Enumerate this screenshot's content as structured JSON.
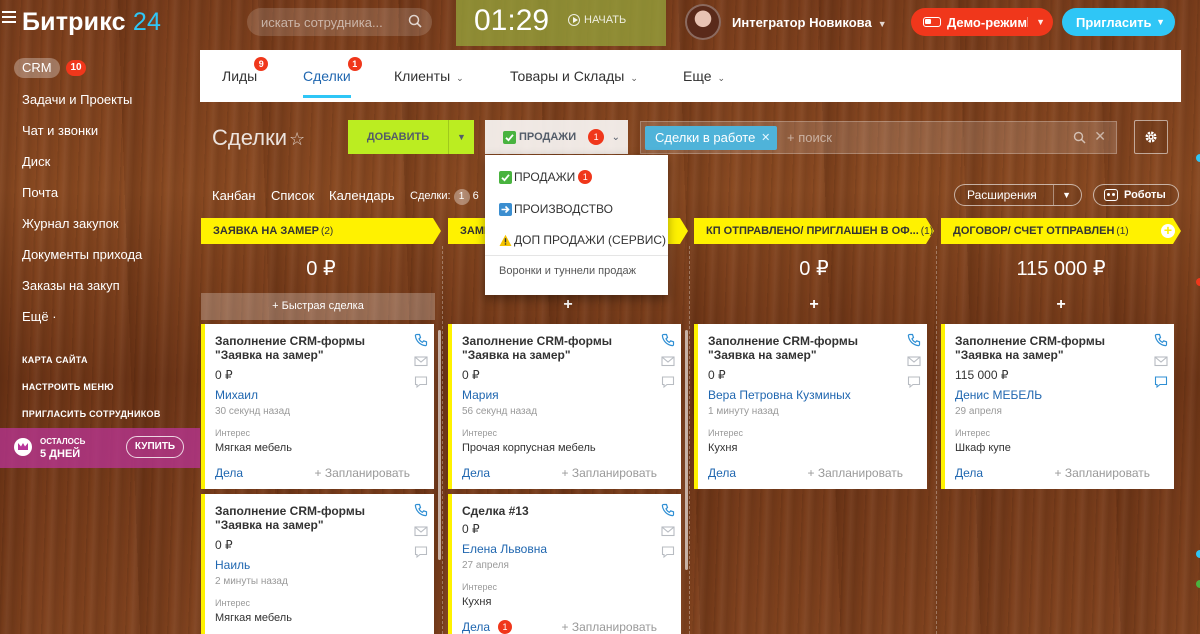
{
  "topbar": {
    "logo_text": "Битрикс",
    "logo_num": "24",
    "search_placeholder": "искать сотрудника...",
    "time": "01:29",
    "start_label": "НАЧАТЬ",
    "user_name": "Интегратор Новикова",
    "demo_label": "Демо-режим",
    "invite_label": "Пригласить"
  },
  "leftmenu": {
    "crm_label": "CRM",
    "crm_count": "10",
    "items": [
      "Задачи и Проекты",
      "Чат и звонки",
      "Диск",
      "Почта",
      "Журнал закупок",
      "Документы прихода",
      "Заказы на закуп",
      "Ещё ·"
    ],
    "small_links": [
      "КАРТА САЙТА",
      "НАСТРОИТЬ МЕНЮ",
      "ПРИГЛАСИТЬ СОТРУДНИКОВ"
    ],
    "trial": {
      "line1": "ОСТАЛОСЬ",
      "line2": "5 ДНЕЙ",
      "buy": "КУПИТЬ"
    }
  },
  "crmnav": {
    "tabs": [
      {
        "label": "Лиды",
        "badge": "9"
      },
      {
        "label": "Сделки",
        "badge": "1"
      },
      {
        "label": "Клиенты",
        "badge": ""
      },
      {
        "label": "Товары и Склады",
        "badge": ""
      },
      {
        "label": "Еще",
        "badge": ""
      }
    ]
  },
  "page": {
    "title": "Сделки",
    "add_label": "ДОБАВИТЬ",
    "funnel_label": "ПРОДАЖИ",
    "funnel_badge": "1",
    "filter_chip": "Сделки в работе",
    "filter_placeholder": "+ поиск",
    "views": [
      "Канбан",
      "Список",
      "Календарь"
    ],
    "deals_label": "Сделки:",
    "deals_count": "1",
    "deals_more": "6",
    "extensions_label": "Расширения",
    "robots_label": "Роботы"
  },
  "dropdown": {
    "items": [
      {
        "label": "ПРОДАЖИ",
        "badge": "1",
        "icon": "check-icon"
      },
      {
        "label": "ПРОИЗВОДСТВО",
        "badge": "",
        "icon": "arrow-right-icon"
      },
      {
        "label": "ДОП ПРОДАЖИ (СЕРВИС)",
        "badge": "",
        "icon": "warning-icon"
      }
    ],
    "footer": "Воронки и туннели продаж"
  },
  "kanban": {
    "quick_deal": "+ Быстрая сделка",
    "columns": [
      {
        "name": "ЗАЯВКА НА ЗАМЕР",
        "count": "(2)",
        "sum": "0 ₽"
      },
      {
        "name": "ЗАМЕ",
        "count": "",
        "sum": ""
      },
      {
        "name": "КП ОТПРАВЛЕНО/ ПРИГЛАШЕН В ОФ...",
        "count": "(1)",
        "sum": "0 ₽"
      },
      {
        "name": "ДОГОВОР/ СЧЕТ ОТПРАВЛЕН",
        "count": "(1)",
        "sum": "115 000 ₽"
      }
    ],
    "cards": [
      {
        "title": "Заполнение CRM-формы \"Заявка на замер\"",
        "sum": "0 ₽",
        "client": "Михаил",
        "date": "30 секунд назад",
        "interest_label": "Интерес",
        "interest": "Мягкая мебель",
        "tasks": "Дела",
        "tasks_badge": "",
        "plan": "+ Запланировать"
      },
      {
        "title": "Заполнение CRM-формы \"Заявка на замер\"",
        "sum": "0 ₽",
        "client": "Наиль",
        "date": "2 минуты назад",
        "interest_label": "Интерес",
        "interest": "Мягкая мебель",
        "tasks": "",
        "tasks_badge": "",
        "plan": ""
      },
      {
        "title": "Заполнение CRM-формы \"Заявка на замер\"",
        "sum": "0 ₽",
        "client": "Мария",
        "date": "56 секунд назад",
        "interest_label": "Интерес",
        "interest": "Прочая корпусная мебель",
        "tasks": "Дела",
        "tasks_badge": "",
        "plan": "+ Запланировать"
      },
      {
        "title": "Сделка #13",
        "sum": "0 ₽",
        "client": "Елена Львовна",
        "date": "27 апреля",
        "interest_label": "Интерес",
        "interest": "Кухня",
        "tasks": "Дела",
        "tasks_badge": "1",
        "plan": "+ Запланировать"
      },
      {
        "title": "Заполнение CRM-формы \"Заявка на замер\"",
        "sum": "0 ₽",
        "client": "Вера Петровна Кузминых",
        "date": "1 минуту назад",
        "interest_label": "Интерес",
        "interest": "Кухня",
        "tasks": "Дела",
        "tasks_badge": "",
        "plan": "+ Запланировать"
      },
      {
        "title": "Заполнение CRM-формы \"Заявка на замер\"",
        "sum": "115 000 ₽",
        "client": "Денис МЕБЕЛЬ",
        "date": "29 апреля",
        "interest_label": "Интерес",
        "interest": "Шкаф купе",
        "tasks": "Дела",
        "tasks_badge": "",
        "plan": "+ Запланировать"
      }
    ]
  },
  "colors": {
    "accent_blue": "#2fc6f6",
    "danger": "#f0371b",
    "lime": "#bbed21",
    "stage_yellow": "#fff200",
    "link_blue": "#2067b0"
  }
}
